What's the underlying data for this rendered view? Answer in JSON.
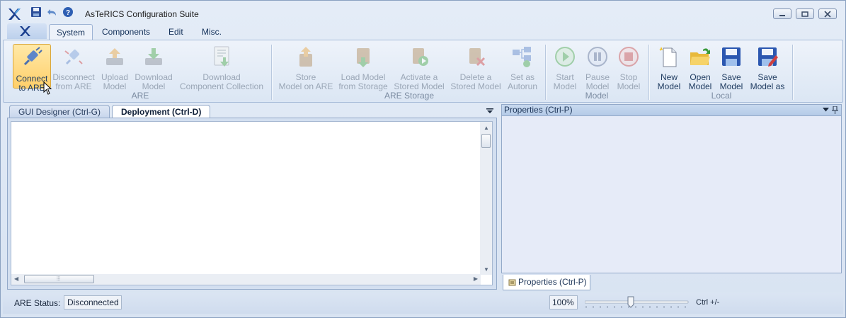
{
  "window": {
    "title": "AsTeRICS Configuration Suite"
  },
  "quick_access": {
    "icons": [
      "save-icon",
      "undo-icon",
      "help-icon"
    ]
  },
  "ribbon_tabs": [
    "System",
    "Components",
    "Edit",
    "Misc."
  ],
  "groups": {
    "are": {
      "label": "ARE",
      "buttons": [
        {
          "line1": "Connect",
          "line2": "to ARE"
        },
        {
          "line1": "Disconnect",
          "line2": "from ARE"
        },
        {
          "line1": "Upload",
          "line2": "Model"
        },
        {
          "line1": "Download",
          "line2": "Model"
        },
        {
          "line1": "Download",
          "line2": "Component Collection"
        }
      ]
    },
    "are_storage": {
      "label": "ARE Storage",
      "buttons": [
        {
          "line1": "Store",
          "line2": "Model on ARE"
        },
        {
          "line1": "Load Model",
          "line2": "from Storage"
        },
        {
          "line1": "Activate a",
          "line2": "Stored Model"
        },
        {
          "line1": "Delete a",
          "line2": "Stored Model"
        },
        {
          "line1": "Set as",
          "line2": "Autorun"
        }
      ]
    },
    "model": {
      "label": "Model",
      "buttons": [
        {
          "line1": "Start",
          "line2": "Model"
        },
        {
          "line1": "Pause",
          "line2": "Model"
        },
        {
          "line1": "Stop",
          "line2": "Model"
        }
      ]
    },
    "local": {
      "label": "Local",
      "buttons": [
        {
          "line1": "New",
          "line2": "Model"
        },
        {
          "line1": "Open",
          "line2": "Model"
        },
        {
          "line1": "Save",
          "line2": "Model"
        },
        {
          "line1": "Save",
          "line2": "Model as"
        }
      ]
    }
  },
  "document_tabs": [
    "GUI Designer (Ctrl-G)",
    "Deployment (Ctrl-D)"
  ],
  "properties": {
    "header": "Properties (Ctrl-P)",
    "tab": "Properties (Ctrl-P)"
  },
  "status": {
    "label": "ARE Status:",
    "value": "Disconnected"
  },
  "zoom": {
    "value": "100%",
    "shortcut": "Ctrl +/-"
  },
  "colors": {
    "accent": "#ffcf6a",
    "frame": "#93a9c9",
    "ribbon": "#dbe6f4"
  }
}
